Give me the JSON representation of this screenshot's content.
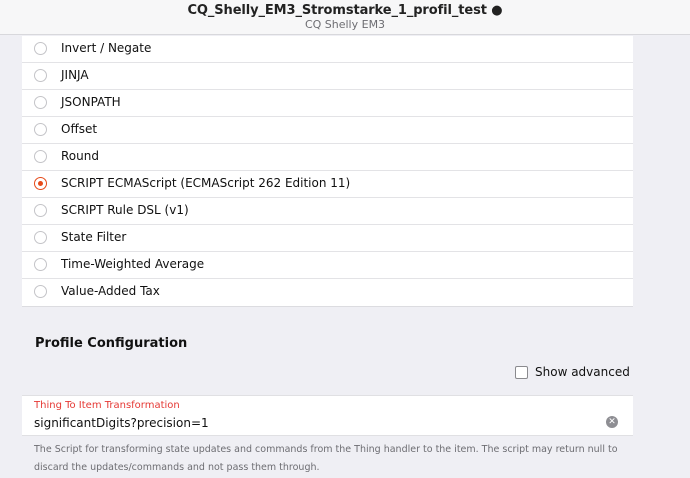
{
  "header": {
    "title": "CQ_Shelly_EM3_Stromstarke_1_profil_test ●",
    "subtitle": "CQ Shelly EM3"
  },
  "profiles": [
    {
      "label": "Invert / Negate",
      "selected": false
    },
    {
      "label": "JINJA",
      "selected": false
    },
    {
      "label": "JSONPATH",
      "selected": false
    },
    {
      "label": "Offset",
      "selected": false
    },
    {
      "label": "Round",
      "selected": false
    },
    {
      "label": "SCRIPT ECMAScript (ECMAScript 262 Edition 11)",
      "selected": true
    },
    {
      "label": "SCRIPT Rule DSL (v1)",
      "selected": false
    },
    {
      "label": "State Filter",
      "selected": false
    },
    {
      "label": "Time-Weighted Average",
      "selected": false
    },
    {
      "label": "Value-Added Tax",
      "selected": false
    }
  ],
  "config": {
    "section_title": "Profile Configuration",
    "show_advanced_label": "Show advanced",
    "show_advanced_checked": false,
    "field_label": "Thing To Item Transformation",
    "field_value": "significantDigits?precision=1",
    "clear_icon": "✕",
    "help_text": "The Script for transforming state updates and commands from the Thing handler to the item. The script may return null to discard the updates/commands and not pass them through."
  },
  "colors": {
    "accent": "#e64a19",
    "field_label": "#e53935"
  }
}
